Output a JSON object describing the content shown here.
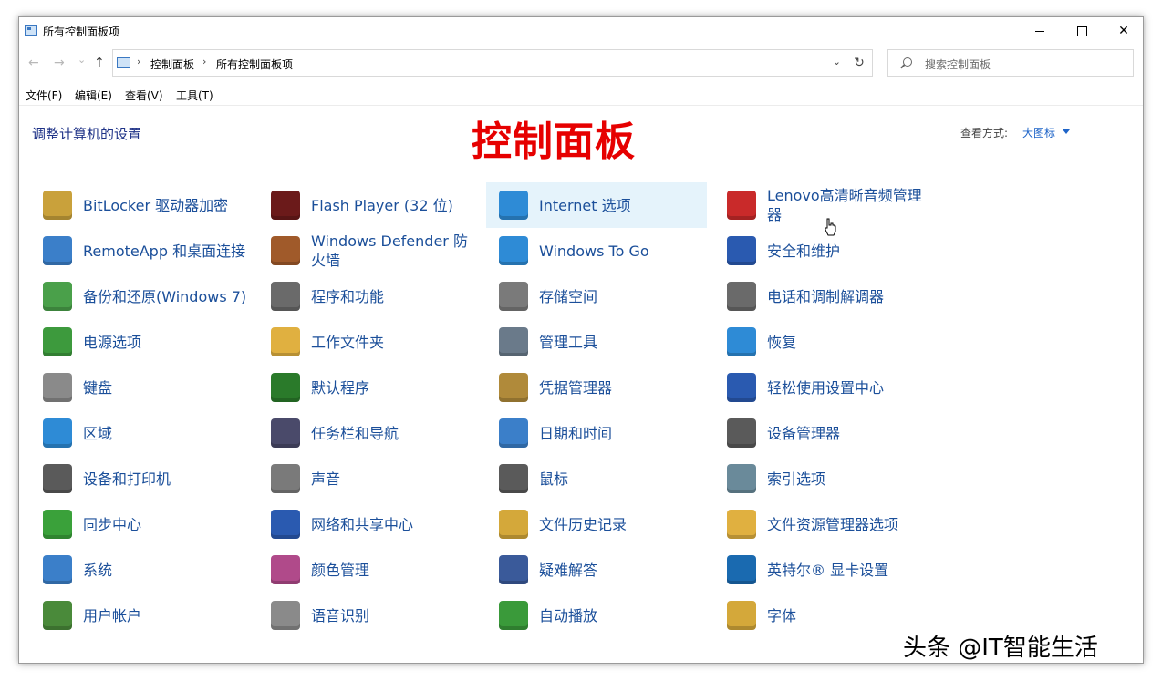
{
  "window": {
    "title": "所有控制面板项"
  },
  "nav": {
    "back": "←",
    "forward": "→",
    "recent": "⌄",
    "up": "↑"
  },
  "address": {
    "crumbs": [
      "控制面板",
      "所有控制面板项"
    ],
    "separator": "›",
    "dropdown": "⌄",
    "refresh": "↻"
  },
  "search": {
    "placeholder": "搜索控制面板"
  },
  "menu": [
    "文件(F)",
    "编辑(E)",
    "查看(V)",
    "工具(T)"
  ],
  "content": {
    "heading": "调整计算机的设置",
    "overlay_title": "控制面板",
    "view_label": "查看方式:",
    "view_value": "大图标"
  },
  "colors": {
    "link": "#1b4f9a",
    "overlay": "#e60000",
    "selected": "#e5f3fb"
  },
  "columns": [
    [
      {
        "label": "BitLocker 驱动器加密",
        "icon": "key-icon",
        "color": "#c9a13b"
      },
      {
        "label": "RemoteApp 和桌面连接",
        "icon": "remote-desktop-icon",
        "color": "#3b7fc9"
      },
      {
        "label": "备份和还原(Windows 7)",
        "icon": "backup-icon",
        "color": "#4aa04a"
      },
      {
        "label": "电源选项",
        "icon": "battery-icon",
        "color": "#3d9a3d"
      },
      {
        "label": "键盘",
        "icon": "keyboard-icon",
        "color": "#8a8a8a"
      },
      {
        "label": "区域",
        "icon": "globe-clock-icon",
        "color": "#2e8bd6"
      },
      {
        "label": "设备和打印机",
        "icon": "printer-icon",
        "color": "#5a5a5a"
      },
      {
        "label": "同步中心",
        "icon": "sync-icon",
        "color": "#3aa13a"
      },
      {
        "label": "系统",
        "icon": "computer-icon",
        "color": "#3b7fc9"
      },
      {
        "label": "用户帐户",
        "icon": "users-icon",
        "color": "#4a8a3a"
      }
    ],
    [
      {
        "label": "Flash Player (32 位)",
        "icon": "flash-icon",
        "color": "#6b1a1a"
      },
      {
        "label": "Windows Defender 防火墙",
        "icon": "firewall-icon",
        "color": "#a05a2a"
      },
      {
        "label": "程序和功能",
        "icon": "programs-icon",
        "color": "#6a6a6a"
      },
      {
        "label": "工作文件夹",
        "icon": "folder-icon",
        "color": "#e0b040"
      },
      {
        "label": "默认程序",
        "icon": "default-programs-icon",
        "color": "#2a7a2a"
      },
      {
        "label": "任务栏和导航",
        "icon": "taskbar-icon",
        "color": "#4a4a6a"
      },
      {
        "label": "声音",
        "icon": "speaker-icon",
        "color": "#7a7a7a"
      },
      {
        "label": "网络和共享中心",
        "icon": "network-icon",
        "color": "#2a5ab0"
      },
      {
        "label": "颜色管理",
        "icon": "color-icon",
        "color": "#b04a8a"
      },
      {
        "label": "语音识别",
        "icon": "microphone-icon",
        "color": "#8a8a8a"
      }
    ],
    [
      {
        "label": "Internet 选项",
        "icon": "internet-icon",
        "color": "#2e8bd6",
        "selected": true
      },
      {
        "label": "Windows To Go",
        "icon": "windows-to-go-icon",
        "color": "#2e8bd6"
      },
      {
        "label": "存储空间",
        "icon": "storage-icon",
        "color": "#7a7a7a"
      },
      {
        "label": "管理工具",
        "icon": "admin-tools-icon",
        "color": "#6a7a8a"
      },
      {
        "label": "凭据管理器",
        "icon": "vault-icon",
        "color": "#b08a3a"
      },
      {
        "label": "日期和时间",
        "icon": "calendar-icon",
        "color": "#3b7fc9"
      },
      {
        "label": "鼠标",
        "icon": "mouse-icon",
        "color": "#5a5a5a"
      },
      {
        "label": "文件历史记录",
        "icon": "file-history-icon",
        "color": "#d4a83a"
      },
      {
        "label": "疑难解答",
        "icon": "troubleshoot-icon",
        "color": "#3a5a9a"
      },
      {
        "label": "自动播放",
        "icon": "autoplay-icon",
        "color": "#3a9a3a"
      }
    ],
    [
      {
        "label": "Lenovo高清晰音频管理器",
        "icon": "audio-manager-icon",
        "color": "#c92a2a"
      },
      {
        "label": "安全和维护",
        "icon": "flag-icon",
        "color": "#2a5ab0"
      },
      {
        "label": "电话和调制解调器",
        "icon": "phone-icon",
        "color": "#6a6a6a"
      },
      {
        "label": "恢复",
        "icon": "recovery-icon",
        "color": "#2e8bd6"
      },
      {
        "label": "轻松使用设置中心",
        "icon": "ease-of-access-icon",
        "color": "#2a5ab0"
      },
      {
        "label": "设备管理器",
        "icon": "device-manager-icon",
        "color": "#5a5a5a"
      },
      {
        "label": "索引选项",
        "icon": "index-icon",
        "color": "#6a8a9a"
      },
      {
        "label": "文件资源管理器选项",
        "icon": "explorer-options-icon",
        "color": "#e0b040"
      },
      {
        "label": "英特尔® 显卡设置",
        "icon": "intel-graphics-icon",
        "color": "#1a6ab0"
      },
      {
        "label": "字体",
        "icon": "fonts-icon",
        "color": "#d4a83a"
      }
    ]
  ],
  "watermark": "头条 @IT智能生活"
}
